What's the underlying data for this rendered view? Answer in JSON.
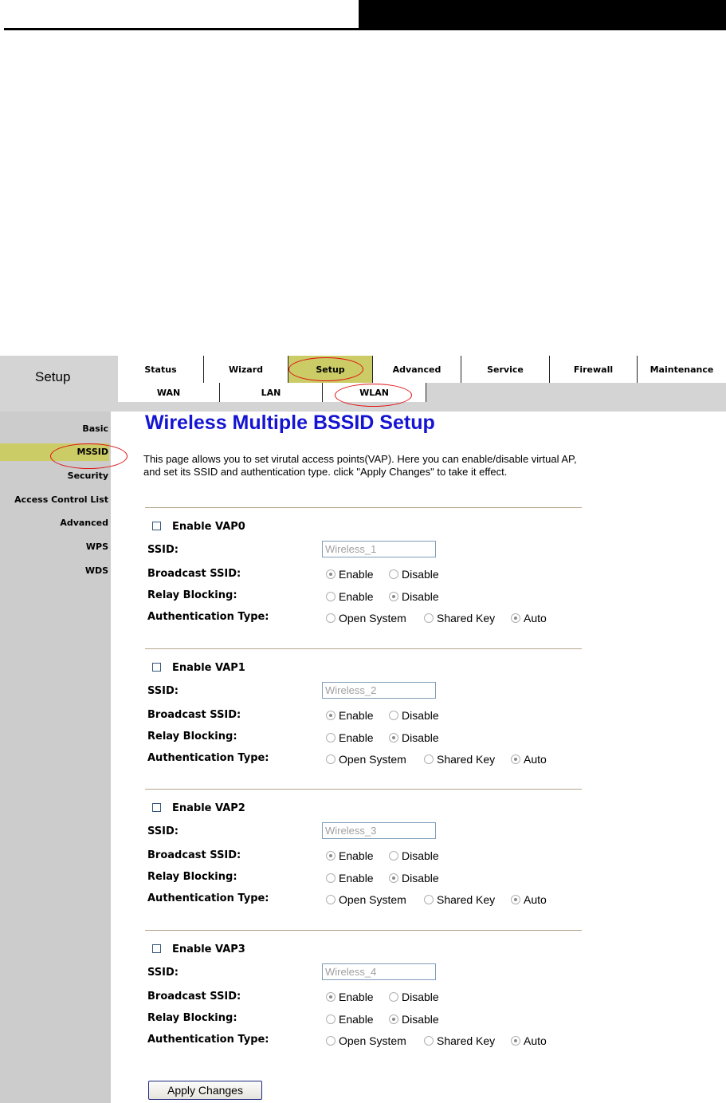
{
  "header": {
    "title": "Setup",
    "tabs": [
      {
        "label": "Status",
        "active": false
      },
      {
        "label": "Wizard",
        "active": false
      },
      {
        "label": "Setup",
        "active": true
      },
      {
        "label": "Advanced",
        "active": false
      },
      {
        "label": "Service",
        "active": false
      },
      {
        "label": "Firewall",
        "active": false
      },
      {
        "label": "Maintenance",
        "active": false
      }
    ],
    "subtabs": [
      {
        "label": "WAN",
        "active": false
      },
      {
        "label": "LAN",
        "active": false
      },
      {
        "label": "WLAN",
        "active": true
      }
    ]
  },
  "sidebar": {
    "items": [
      {
        "label": "Basic",
        "active": false
      },
      {
        "label": "MSSID",
        "active": true
      },
      {
        "label": "Security",
        "active": false
      },
      {
        "label": "Access Control List",
        "active": false
      },
      {
        "label": "Advanced",
        "active": false
      },
      {
        "label": "WPS",
        "active": false
      },
      {
        "label": "WDS",
        "active": false
      }
    ]
  },
  "main": {
    "title": "Wireless Multiple BSSID Setup",
    "description": "This page allows you to set virutal access points(VAP). Here you can enable/disable virtual AP, and set its SSID and authentication type. click \"Apply Changes\" to take it effect.",
    "labels": {
      "ssid": "SSID:",
      "broadcast": "Broadcast SSID:",
      "relay": "Relay Blocking:",
      "auth": "Authentication Type:",
      "enable": "Enable",
      "disable": "Disable",
      "open_system": "Open System",
      "shared_key": "Shared Key",
      "auto": "Auto"
    },
    "vaps": [
      {
        "enable_label": "Enable VAP0",
        "enabled": false,
        "ssid": "Wireless_1",
        "broadcast": "Enable",
        "relay": "Disable",
        "auth": "Auto"
      },
      {
        "enable_label": "Enable VAP1",
        "enabled": false,
        "ssid": "Wireless_2",
        "broadcast": "Enable",
        "relay": "Disable",
        "auth": "Auto"
      },
      {
        "enable_label": "Enable VAP2",
        "enabled": false,
        "ssid": "Wireless_3",
        "broadcast": "Enable",
        "relay": "Disable",
        "auth": "Auto"
      },
      {
        "enable_label": "Enable VAP3",
        "enabled": false,
        "ssid": "Wireless_4",
        "broadcast": "Enable",
        "relay": "Disable",
        "auth": "Auto"
      }
    ],
    "apply_label": "Apply Changes"
  },
  "colors": {
    "active_tab": "#cccc66",
    "title_blue": "#1414d2",
    "annotation_red": "#e01010",
    "sidebar_gray": "#cccccc"
  }
}
